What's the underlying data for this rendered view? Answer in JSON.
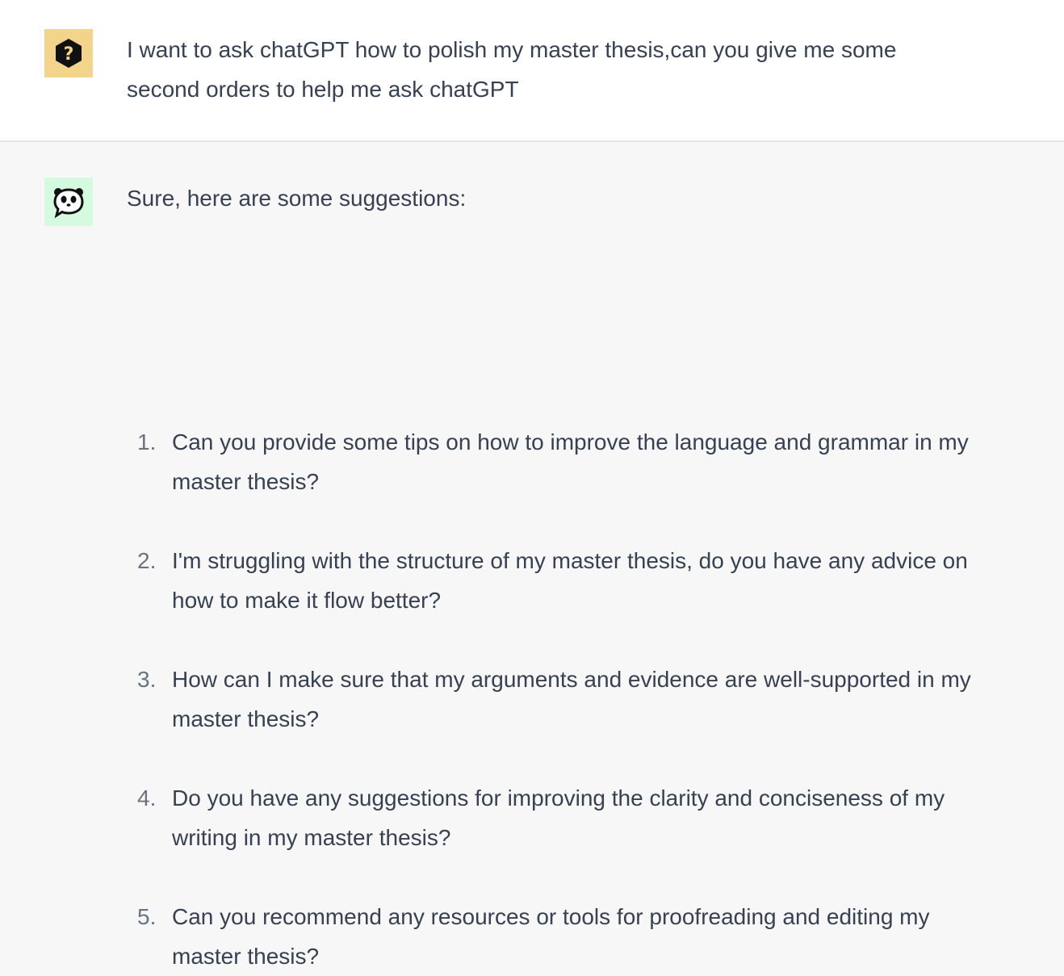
{
  "conversation": {
    "user": {
      "avatar_icon": "question-hexagon-icon",
      "avatar_bg": "#f2d48a",
      "text": "I want to ask chatGPT how to polish my master thesis,can you give me some second orders to help me ask chatGPT"
    },
    "assistant": {
      "avatar_icon": "panda-chat-icon",
      "avatar_bg": "#d4fbe0",
      "intro": "Sure, here are some suggestions:",
      "suggestions": [
        {
          "number": "1.",
          "text": "Can you provide some tips on how to improve the language and grammar in my master thesis?"
        },
        {
          "number": "2.",
          "text": "I'm struggling with the structure of my master thesis, do you have any advice on how to make it flow better?"
        },
        {
          "number": "3.",
          "text": "How can I make sure that my arguments and evidence are well-supported in my master thesis?"
        },
        {
          "number": "4.",
          "text": "Do you have any suggestions for improving the clarity and conciseness of my writing in my master thesis?"
        },
        {
          "number": "5.",
          "text": "Can you recommend any resources or tools for proofreading and editing my master thesis?"
        }
      ]
    }
  }
}
